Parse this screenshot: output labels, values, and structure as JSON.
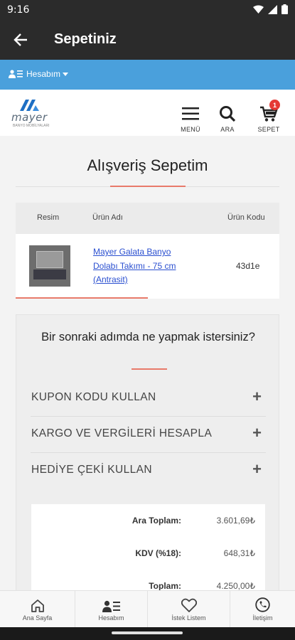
{
  "status_bar": {
    "time": "9:16"
  },
  "app_bar": {
    "title": "Sepetiniz"
  },
  "account": {
    "label": "Hesabım"
  },
  "site_header": {
    "logo_text": "mayer",
    "logo_sub": "BANYO MOBİLYALARI",
    "menu_label": "MENÜ",
    "search_label": "ARA",
    "cart_label": "SEPET",
    "cart_count": "1"
  },
  "page": {
    "title": "Alışveriş Sepetim"
  },
  "cart_table": {
    "headers": [
      "Resim",
      "Ürün Adı",
      "Ürün Kodu"
    ],
    "rows": [
      {
        "name": "Mayer Galata Banyo Dolabı Takımı - 75 cm (Antrasit)",
        "code": "43d1e"
      }
    ]
  },
  "next_step": {
    "question": "Bir sonraki adımda ne yapmak istersiniz?",
    "options": [
      "KUPON KODU KULLAN",
      "KARGO VE VERGİLERİ HESAPLA",
      "HEDİYE ÇEKİ KULLAN"
    ]
  },
  "totals": [
    {
      "label": "Ara Toplam:",
      "value": "3.601,69₺"
    },
    {
      "label": "KDV (%18):",
      "value": "648,31₺"
    },
    {
      "label": "Toplam:",
      "value": "4.250,00₺"
    }
  ],
  "bottom_nav": [
    {
      "label": "Ana Sayfa",
      "icon": "home-icon"
    },
    {
      "label": "Hesabım",
      "icon": "account-icon"
    },
    {
      "label": "İstek Listem",
      "icon": "heart-icon"
    },
    {
      "label": "İletişim",
      "icon": "phone-icon"
    }
  ],
  "colors": {
    "topbar": "#2b2b2b",
    "account_strip": "#4aa0dc",
    "accent": "#e87a6a",
    "link": "#2a4fd0",
    "badge": "#e53935"
  }
}
